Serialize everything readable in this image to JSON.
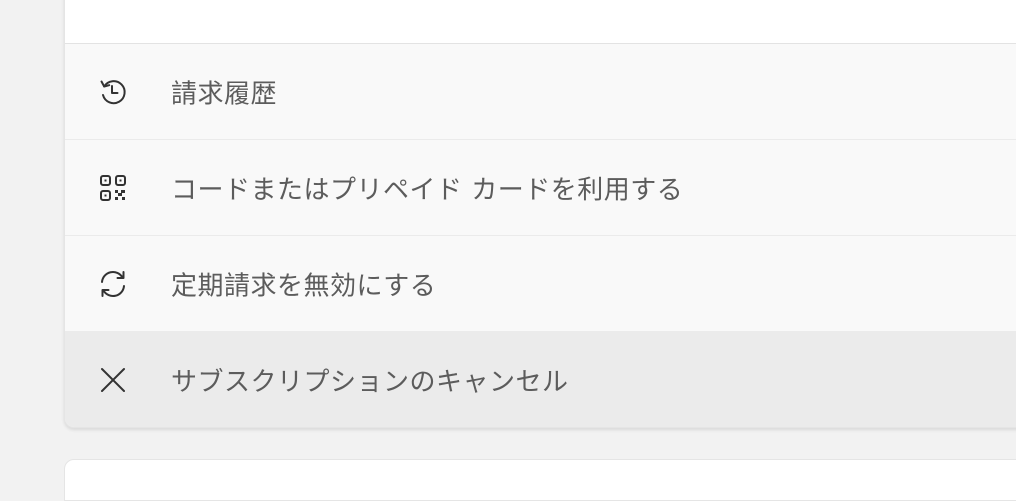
{
  "menu": {
    "items": [
      {
        "label": "請求履歴",
        "icon": "history-icon"
      },
      {
        "label": "コードまたはプリペイド カードを利用する",
        "icon": "qr-code-icon"
      },
      {
        "label": "定期請求を無効にする",
        "icon": "sync-icon"
      },
      {
        "label": "サブスクリプションのキャンセル",
        "icon": "close-icon"
      }
    ]
  },
  "colors": {
    "page_background": "#f2f2f2",
    "panel_background": "#f9f9f9",
    "hover_background": "#ebebeb",
    "text": "#5c5c5c",
    "icon": "#333333"
  }
}
